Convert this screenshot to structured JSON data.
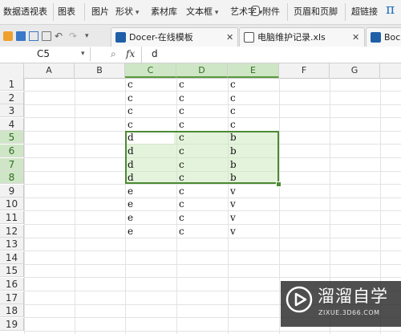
{
  "ribbon": {
    "pivot_table": "数据透视表",
    "chart": "图表",
    "picture": "图片",
    "shapes": "形状",
    "material_library": "素材库",
    "text_box": "文本框",
    "art_text": "艺术字",
    "attachment": "附件",
    "header_footer": "页眉和页脚",
    "hyperlink": "超链接",
    "pi_symbol": "π"
  },
  "tabs": [
    {
      "label": "Docer-在线模板",
      "icon": "docer-icon"
    },
    {
      "label": "电脑维护记录.xls",
      "icon": "spreadsheet-icon"
    },
    {
      "label": "Boc",
      "icon": "document-icon"
    }
  ],
  "formula_bar": {
    "cell_ref": "C5",
    "fx": "fx",
    "content": "d"
  },
  "columns": [
    "A",
    "B",
    "C",
    "D",
    "E",
    "F",
    "G"
  ],
  "rows": [
    "1",
    "2",
    "3",
    "4",
    "5",
    "6",
    "7",
    "8",
    "9",
    "10",
    "11",
    "12",
    "13",
    "14",
    "15",
    "16",
    "17",
    "18",
    "19"
  ],
  "cells": {
    "C": [
      "c",
      "c",
      "c",
      "c",
      "d",
      "d",
      "d",
      "d",
      "e",
      "e",
      "e",
      "e"
    ],
    "D": [
      "c",
      "c",
      "c",
      "c",
      "c",
      "c",
      "c",
      "c",
      "c",
      "c",
      "c",
      "c"
    ],
    "E": [
      "c",
      "c",
      "c",
      "c",
      "b",
      "b",
      "b",
      "b",
      "v",
      "v",
      "v",
      "v"
    ]
  },
  "selection": {
    "range": "C5:E8",
    "active": "C5"
  },
  "watermark": {
    "title": "溜溜自学",
    "url": "ZIXUE.3D66.COM"
  },
  "colors": {
    "selection_border": "#4c8a34",
    "selection_fill": "#cee9be",
    "header_selected": "#cfe6c6"
  }
}
